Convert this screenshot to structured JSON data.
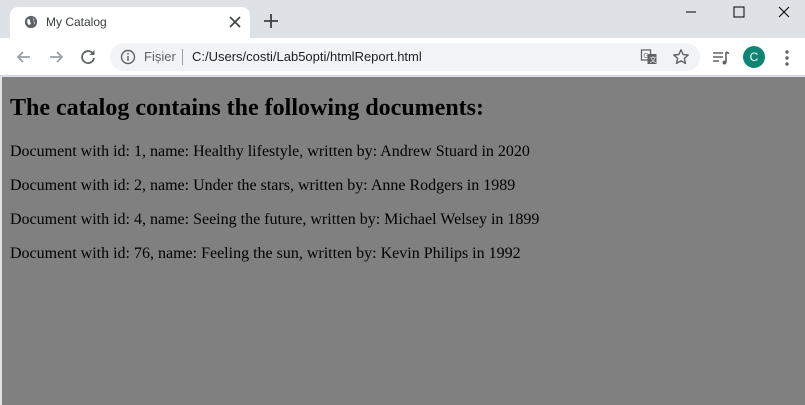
{
  "tab": {
    "title": "My Catalog"
  },
  "address_bar": {
    "scheme_label": "Fișier",
    "url": "C:/Users/costi/Lab5opti/htmlReport.html"
  },
  "profile": {
    "initial": "C",
    "color": "#0f8574"
  },
  "page": {
    "background": "#808080",
    "heading": "The catalog contains the following documents:",
    "documents": [
      "Document with id: 1, name: Healthy lifestyle, written by: Andrew Stuard in 2020",
      "Document with id: 2, name: Under the stars, written by: Anne Rodgers in 1989",
      "Document with id: 4, name: Seeing the future, written by: Michael Welsey in 1899",
      "Document with id: 76, name: Feeling the sun, written by: Kevin Philips in 1992"
    ]
  },
  "icons": {
    "tab_favicon": "globe-icon",
    "tab_close": "close-icon",
    "new_tab": "plus-icon",
    "minimize": "minimize-icon",
    "maximize": "maximize-icon",
    "window_close": "close-icon",
    "back": "arrow-left-icon",
    "forward": "arrow-right-icon",
    "reload": "reload-icon",
    "info": "info-icon",
    "translate": "translate-icon",
    "bookmark": "star-icon",
    "media": "media-control-icon",
    "menu": "kebab-menu-icon"
  }
}
